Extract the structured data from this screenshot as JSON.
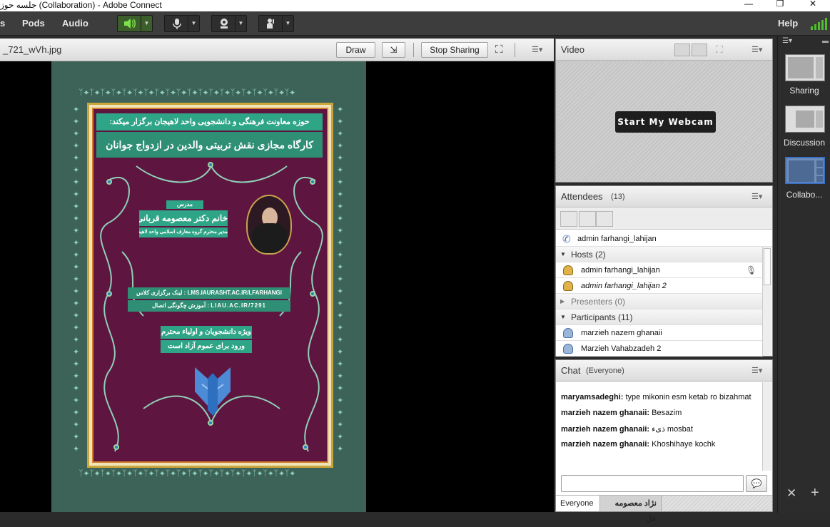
{
  "window": {
    "title": "جلسه حوز (Collaboration) - Adobe Connect",
    "controls": [
      "—",
      "❐",
      "✕"
    ]
  },
  "menubar": {
    "items": [
      "s",
      "Pods",
      "Audio"
    ],
    "help": "Help"
  },
  "share_pod": {
    "file_name": "_721_wVh.jpg",
    "draw_label": "Draw",
    "stop_sharing_label": "Stop Sharing",
    "poster": {
      "header_line1": "حوزه معاونت فرهنگی و دانشجویی واحد لاهیجان برگزار میکند:",
      "header_line2": "کارگاه مجازی نقش تربیتی والدین در ازدواج جوانان",
      "teacher_label": "مدرس",
      "teacher_name": "خانم دکتر معصومه قربانی",
      "teacher_desc": "مدیر محترم گروه معارف اسلامی واحد لاهیجان",
      "link_line1": "لینک برگزاری کلاس : LMS.IAURASHT.AC.IR/LFARHANGI",
      "link_line2": "آموزش چگونگی اتصال : LIAU.AC.IR/7291",
      "audience_line1": "ویژه دانشجویان و اولیاء محترم",
      "audience_line2": "ورود برای عموم آزاد است"
    }
  },
  "video_pod": {
    "title": "Video",
    "start_webcam_label": "Start My Webcam"
  },
  "attendees_pod": {
    "title": "Attendees",
    "count": "(13)",
    "self": "admin farhangi_lahijan",
    "hosts_group": "Hosts (2)",
    "hosts": [
      "admin farhangi_lahijan",
      "admin farhangi_lahijan 2"
    ],
    "presenters_group": "Presenters (0)",
    "participants_group": "Participants (11)",
    "participants": [
      "marzieh nazem ghanaii",
      "Marzieh Vahabzadeh 2"
    ]
  },
  "chat_pod": {
    "title": "Chat",
    "scope": "(Everyone)",
    "messages": [
      {
        "sender": "maryamsadeghi:",
        "text": " type mikonin esm ketab ro bizahmat"
      },
      {
        "sender": "marzieh nazem ghanaii:",
        "text": " Besazim"
      },
      {
        "sender": "marzieh nazem ghanaii:",
        "text": " ذیء mosbat"
      },
      {
        "sender": "marzieh nazem ghanaii:",
        "text": " Khoshihaye kochk"
      }
    ],
    "tabs": [
      "Everyone",
      "نژاد معصومه عل"
    ]
  },
  "layouts": {
    "items": [
      "Sharing",
      "Discussion",
      "Collabo..."
    ]
  },
  "colors": {
    "accent_green": "#4fbf2a",
    "poster_bg": "#3d6358",
    "poster_frame": "#5e1540",
    "banner": "#2fa588",
    "selected_layout": "#3a6fc4"
  }
}
